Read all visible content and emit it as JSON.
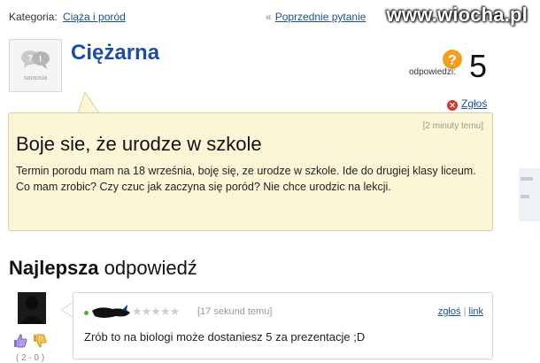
{
  "header": {
    "category_label": "Kategoria:",
    "category_link": "Ciąża i poród",
    "prev_link": "Poprzednie pytanie",
    "prev_arrow": "«",
    "watermark": "www.wiocha.pl"
  },
  "asker": {
    "username": "Ciężarna",
    "avatar_logo_text": "samosia"
  },
  "answers": {
    "label": "odpowiedzi:",
    "count": "5",
    "icon": "question-mark-badge-icon"
  },
  "report": {
    "label": "Zgłoś",
    "icon": "close-circle-icon"
  },
  "question": {
    "time": "[2 minuty temu]",
    "title": "Boje sie, że urodze w szkole",
    "body": "Termin porodu mam na 18 września, boję się, ze urodze w szkole. Ide do drugiej klasy liceum. Co mam zrobic? Czy czuc jak zaczyna się poród? Nie chce urodzic na lekcji."
  },
  "best_answer": {
    "heading_bold": "Najlepsza",
    "heading_rest": " odpowiedź",
    "time": "[17 sekund temu]",
    "report_link": "zgłoś",
    "link_link": "link",
    "separator": "|",
    "stars": "★★★★★",
    "text": "Zrób to na biologi może dostaniesz 5 za prezentacje ;D",
    "votes": "( 2 - 0 )"
  },
  "colors": {
    "link": "#1a4fa0",
    "question_bg": "#fbf6d6",
    "report_icon": "#d8322d",
    "answers_badge": "#f0a020"
  }
}
